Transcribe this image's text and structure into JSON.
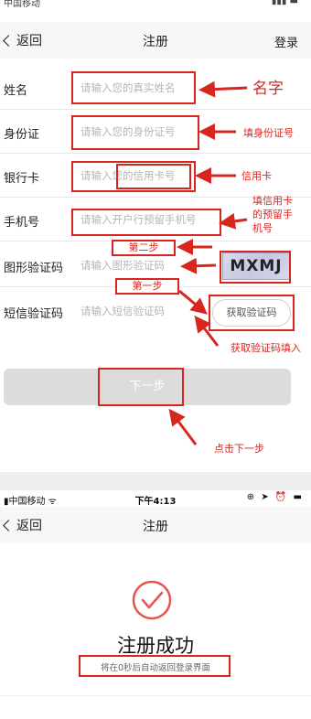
{
  "top_status": {
    "left": "中国移动 ",
    "right": "▮▮▮ ▬"
  },
  "register_nav": {
    "back": "返回",
    "title": "注册",
    "right_action": "登录"
  },
  "form": {
    "rows": [
      {
        "label": "姓名",
        "placeholder": "请输入您的真实姓名"
      },
      {
        "label": "身份证",
        "placeholder": "请输入您的身份证号"
      },
      {
        "label": "银行卡",
        "placeholder": "请输入您的信用卡号"
      },
      {
        "label": "手机号",
        "placeholder": "请输入开户行预留手机号"
      },
      {
        "label": "图形验证码",
        "placeholder": "请输入图形验证码"
      },
      {
        "label": "短信验证码",
        "placeholder": "请输入短信验证码"
      }
    ],
    "captcha_text": "MXMJ",
    "get_code_label": "获取验证码",
    "next_label": "下一步"
  },
  "annotations": {
    "name": "名字",
    "id": "填身份证号",
    "card": "信用卡",
    "phone": "填信用卡的预留手机号",
    "step_two": "第二步",
    "step_one": "第一步",
    "get_code": "获取验证码填入",
    "click_next": "点击下一步"
  },
  "bottom_status": {
    "carrier": "中国移动",
    "time": "下午4:13",
    "icons": "⊕ ➤ ⏰ ▬"
  },
  "success_nav": {
    "back": "返回",
    "title": "注册"
  },
  "success": {
    "title": "注册成功",
    "note": "将在0秒后自动返回登录界面"
  },
  "colors": {
    "annotation_red": "#d8261f",
    "success_red": "#e8534e"
  }
}
